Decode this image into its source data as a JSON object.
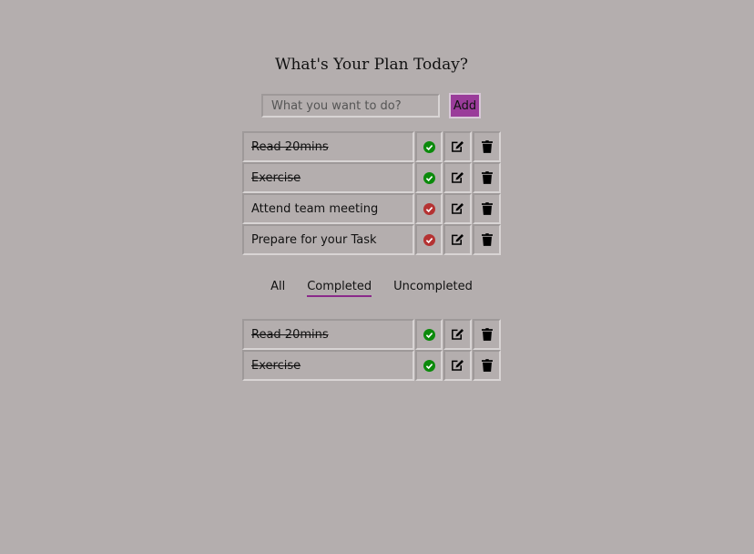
{
  "header": {
    "title": "What's Your Plan Today?"
  },
  "add_form": {
    "placeholder": "What you want to do?",
    "value": "",
    "add_label": "Add"
  },
  "colors": {
    "accent": "#9a3c9a",
    "done_check": "#0b8a0b",
    "pending_check": "#b53232",
    "background": "#b4aeae"
  },
  "tasks": [
    {
      "text": "Read 20mins",
      "completed": true,
      "status_icon": "check-circle-green-icon"
    },
    {
      "text": "Exercise",
      "completed": true,
      "status_icon": "check-circle-green-icon"
    },
    {
      "text": "Attend team meeting",
      "completed": false,
      "status_icon": "check-circle-red-icon"
    },
    {
      "text": "Prepare for your Task",
      "completed": false,
      "status_icon": "check-circle-red-icon"
    }
  ],
  "filters": {
    "items": [
      "All",
      "Completed",
      "Uncompleted"
    ],
    "selected": "Completed"
  },
  "filtered_tasks": [
    {
      "text": "Read 20mins",
      "completed": true,
      "status_icon": "check-circle-green-icon"
    },
    {
      "text": "Exercise",
      "completed": true,
      "status_icon": "check-circle-green-icon"
    }
  ]
}
